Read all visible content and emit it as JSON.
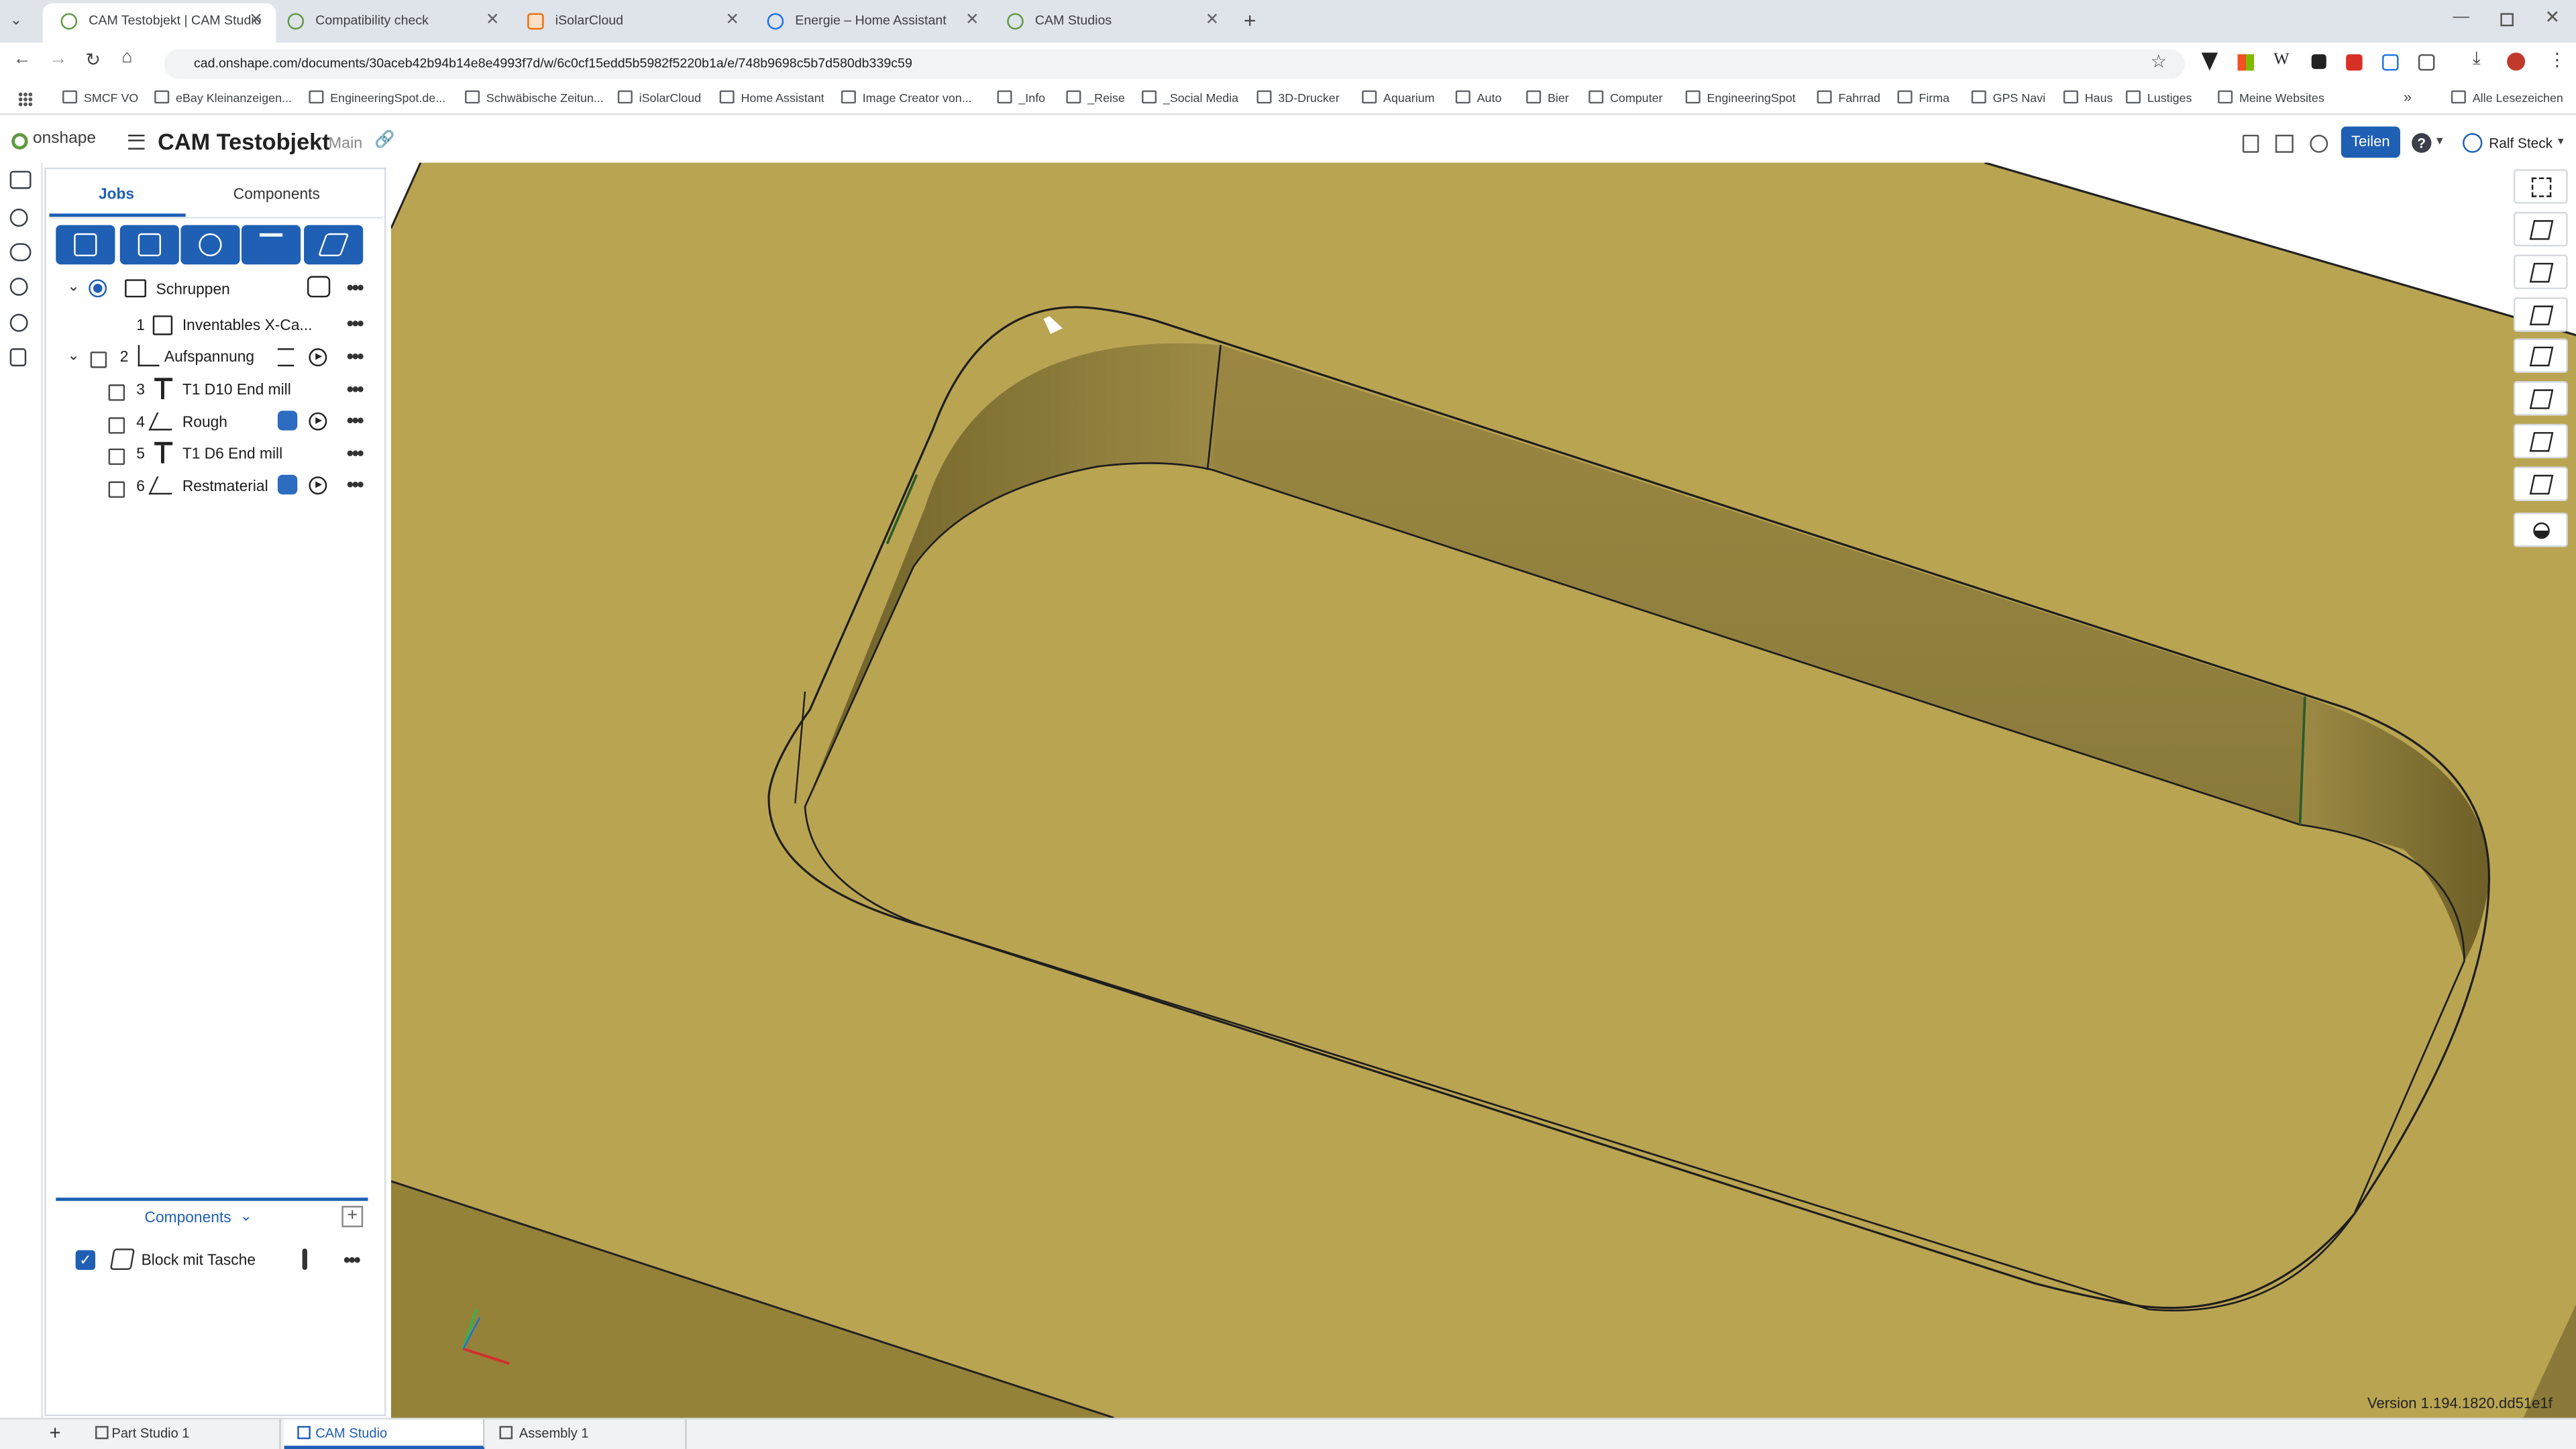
{
  "browser": {
    "tabs": [
      {
        "title": "CAM Testobjekt | CAM Studio",
        "active": true
      },
      {
        "title": "Compatibility check"
      },
      {
        "title": "iSolarCloud"
      },
      {
        "title": "Energie – Home Assistant"
      },
      {
        "title": "CAM Studios"
      }
    ],
    "new_tab": "+",
    "url": "cad.onshape.com/documents/30aceb42b94b14e8e4993f7d/w/6c0cf15edd5b5982f5220b1a/e/748b9698c5b7d580db339c59",
    "bookmarks": [
      "SMCF VO",
      "eBay Kleinanzeigen...",
      "EngineeringSpot.de...",
      "Schwäbische Zeitun...",
      "iSolarCloud",
      "Home Assistant",
      "Image Creator von...",
      "_Info",
      "_Reise",
      "_Social Media",
      "3D-Drucker",
      "Aquarium",
      "Auto",
      "Bier",
      "Computer",
      "EngineeringSpot",
      "Fahrrad",
      "Firma",
      "GPS Navi",
      "Haus",
      "Lustiges",
      "Meine Websites"
    ],
    "all_bookmarks": "Alle Lesezeichen"
  },
  "app": {
    "logo": "onshape",
    "doc_title": "CAM Testobjekt",
    "branch": "Main",
    "share": "Teilen",
    "user": "Ralf Steck",
    "help": "?"
  },
  "panel": {
    "tabs": [
      "Jobs",
      "Components"
    ],
    "tree": [
      {
        "num": "",
        "label": "Schruppen"
      },
      {
        "num": "1",
        "label": "Inventables X-Ca..."
      },
      {
        "num": "2",
        "label": "Aufspannung"
      },
      {
        "num": "3",
        "label": "T1 D10 End mill"
      },
      {
        "num": "4",
        "label": "Rough"
      },
      {
        "num": "5",
        "label": "T1 D6 End mill"
      },
      {
        "num": "6",
        "label": "Restmaterial"
      }
    ],
    "more": "•••",
    "components_header": "Components",
    "components_add": "+",
    "component": "Block mit Tasche"
  },
  "bottom_tabs": [
    "Part Studio 1",
    "CAM Studio",
    "Assembly 1"
  ],
  "bottom_add": "+",
  "version": "Version 1.194.1820.dd51e1f",
  "colors": {
    "accent": "#1f5fb4",
    "model_top": "#b9a452",
    "model_wall": "#8e7b3b"
  }
}
